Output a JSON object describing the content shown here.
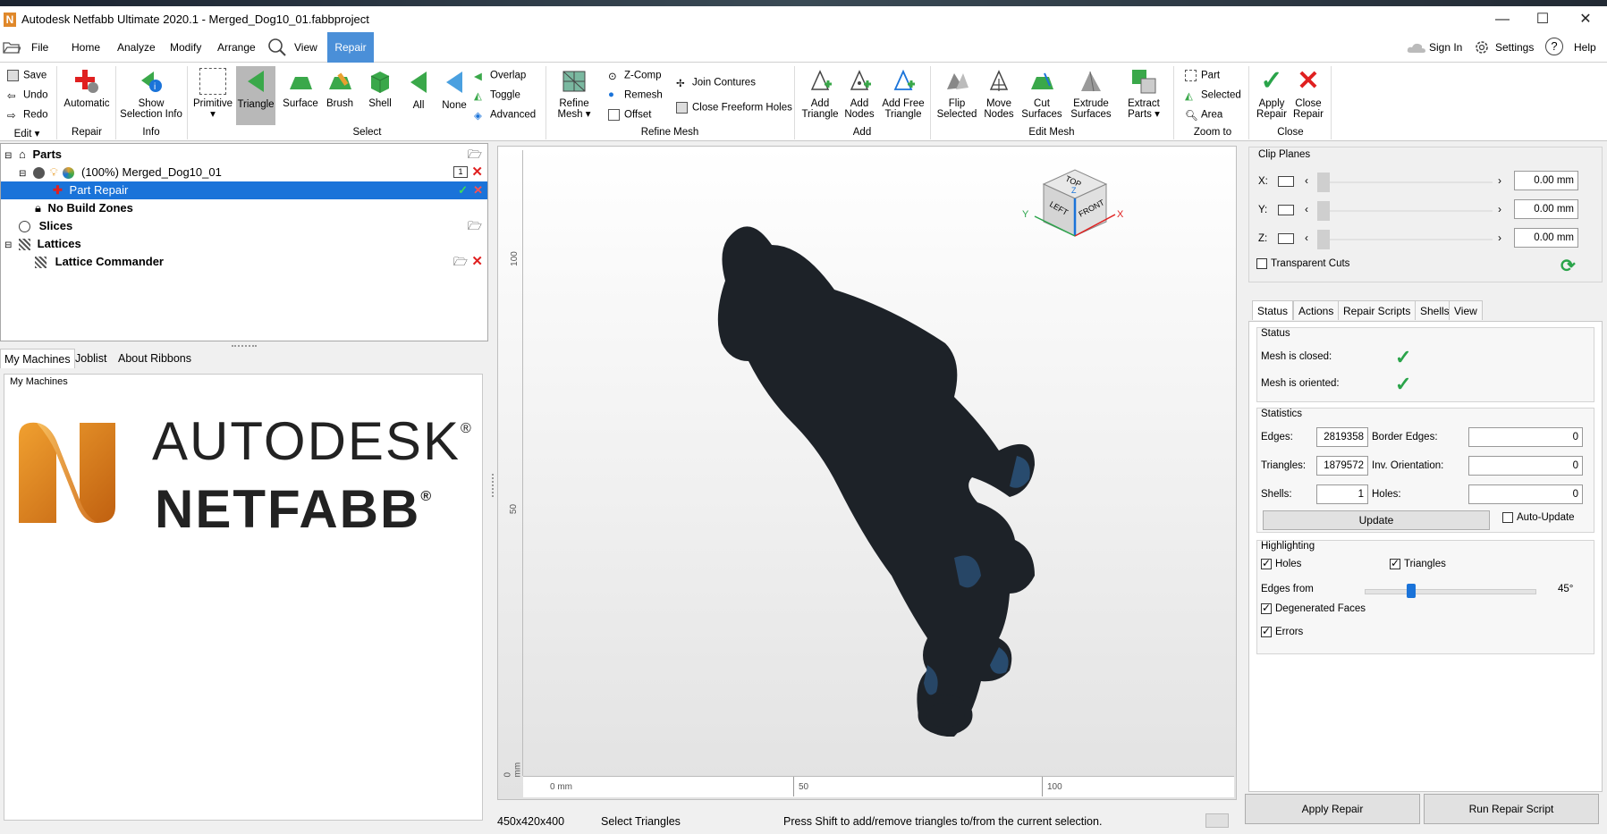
{
  "window": {
    "title": "Autodesk Netfabb Ultimate 2020.1 - Merged_Dog10_01.fabbproject",
    "minimize": "—",
    "maximize": "☐",
    "close": "✕"
  },
  "menu": {
    "items": [
      "File",
      "Home",
      "Analyze",
      "Modify",
      "Arrange",
      "View",
      "Repair"
    ],
    "sign_in": "Sign In",
    "settings": "Settings",
    "help": "Help"
  },
  "ribbon": {
    "edit": {
      "save": "Save",
      "undo": "Undo",
      "redo": "Redo",
      "group": "Edit"
    },
    "repair": {
      "automatic": "Automatic",
      "group": "Repair"
    },
    "info": {
      "show_selection_info": "Show Selection Info",
      "group": "Info"
    },
    "select": {
      "primitive": "Primitive",
      "triangle": "Triangle",
      "surface": "Surface",
      "brush": "Brush",
      "shell": "Shell",
      "all": "All",
      "none": "None",
      "overlap": "Overlap",
      "toggle": "Toggle",
      "advanced": "Advanced",
      "group": "Select"
    },
    "refine": {
      "refine_mesh": "Refine Mesh",
      "zcomp": "Z-Comp",
      "remesh": "Remesh",
      "offset": "Offset",
      "join_contures": "Join Contures",
      "close_freeform_holes": "Close Freeform Holes",
      "group": "Refine Mesh"
    },
    "add": {
      "add_triangle": "Add Triangle",
      "add_nodes": "Add Nodes",
      "add_free_triangle": "Add Free Triangle",
      "group": "Add"
    },
    "editmesh": {
      "flip_selected": "Flip Selected",
      "move_nodes": "Move Nodes",
      "cut_surfaces": "Cut Surfaces",
      "extrude_surfaces": "Extrude Surfaces",
      "extract_parts": "Extract Parts",
      "group": "Edit Mesh"
    },
    "zoom": {
      "part": "Part",
      "selected": "Selected",
      "area": "Area",
      "group": "Zoom to"
    },
    "close": {
      "apply_repair": "Apply Repair",
      "close_repair": "Close Repair",
      "group": "Close"
    }
  },
  "tree": {
    "parts": "Parts",
    "merged": "(100%) Merged_Dog10_01",
    "part_repair": "Part Repair",
    "no_build_zones": "No Build Zones",
    "slices": "Slices",
    "lattices": "Lattices",
    "lattice_commander": "Lattice Commander"
  },
  "left_tabs": [
    "My Machines",
    "Joblist",
    "About Ribbons"
  ],
  "machines": {
    "label": "My Machines",
    "logo_line1": "AUTODESK",
    "logo_line2": "NETFABB"
  },
  "viewport": {
    "ruler_left": [
      "100",
      "50",
      "0 mm"
    ],
    "ruler_bottom": [
      "0 mm",
      "50",
      "100"
    ],
    "cube": {
      "top": "TOP",
      "left": "LEFT",
      "front": "FRONT",
      "axis_x": "X",
      "axis_y": "Y",
      "axis_z": "Z"
    }
  },
  "clip_planes": {
    "title": "Clip Planes",
    "x_label": "X:",
    "y_label": "Y:",
    "z_label": "Z:",
    "x_value": "0.00 mm",
    "y_value": "0.00 mm",
    "z_value": "0.00 mm",
    "transparent_cuts": "Transparent Cuts"
  },
  "right_tabs": [
    "Status",
    "Actions",
    "Repair Scripts",
    "Shells",
    "View"
  ],
  "status": {
    "title": "Status",
    "mesh_closed": "Mesh is closed:",
    "mesh_oriented": "Mesh is oriented:"
  },
  "statistics": {
    "title": "Statistics",
    "edges_label": "Edges:",
    "edges": "2819358",
    "triangles_label": "Triangles:",
    "triangles": "1879572",
    "shells_label": "Shells:",
    "shells": "1",
    "border_edges_label": "Border Edges:",
    "border_edges": "0",
    "inv_orientation_label": "Inv. Orientation:",
    "inv_orientation": "0",
    "holes_label": "Holes:",
    "holes": "0",
    "update": "Update",
    "auto_update": "Auto-Update"
  },
  "highlighting": {
    "title": "Highlighting",
    "holes": "Holes",
    "triangles": "Triangles",
    "edges_from": "Edges from",
    "edges_from_value": "45°",
    "edges_slider_fraction": 0.26,
    "degenerated_faces": "Degenerated Faces",
    "errors": "Errors"
  },
  "buttons": {
    "apply_repair": "Apply Repair",
    "run_repair_script": "Run Repair Script"
  },
  "statusbar": {
    "size": "450x420x400",
    "mode": "Select Triangles",
    "hint": "Press Shift to add/remove triangles to/from the current selection."
  },
  "colors": {
    "accent": "#1a73d9",
    "repair_tab": "#4a8fd8",
    "green": "#2aa44a",
    "red": "#e02020",
    "mesh": "#1d2228"
  }
}
